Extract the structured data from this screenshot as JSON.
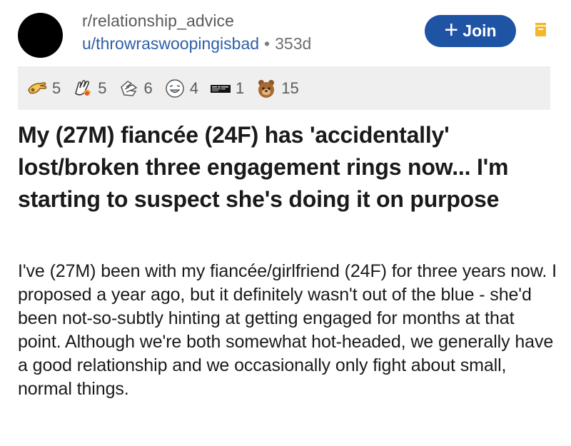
{
  "post": {
    "subreddit": "r/relationship_advice",
    "username": "u/throwraswoopingisbad",
    "separator": "•",
    "age": "353d",
    "join_label": "Join",
    "awards": [
      {
        "icon": "helpful-hand-icon",
        "count": "5"
      },
      {
        "icon": "wholesome-hands-icon",
        "count": "5"
      },
      {
        "icon": "hug-icon",
        "count": "6"
      },
      {
        "icon": "laughing-face-icon",
        "count": "4"
      },
      {
        "icon": "black-card-icon",
        "count": "1"
      },
      {
        "icon": "bear-icon",
        "count": "15"
      }
    ],
    "title": "My (27M) fiancée (24F) has 'accidentally' lost/broken three engagement rings now... I'm starting to suspect she's doing it on purpose",
    "body": "I've (27M) been with my fiancée/girlfriend (24F) for three years now. I proposed a year ago, but it definitely wasn't out of the blue - she'd been not-so-subtly hinting at getting engaged for months at that point. Although we're both somewhat hot-headed, we generally have a good relationship and we occasionally only fight about small, normal things."
  },
  "colors": {
    "join_button": "#1f53a4",
    "username": "#2f5fa8",
    "save_icon": "#f3b72b",
    "awards_bg": "#efefef"
  }
}
